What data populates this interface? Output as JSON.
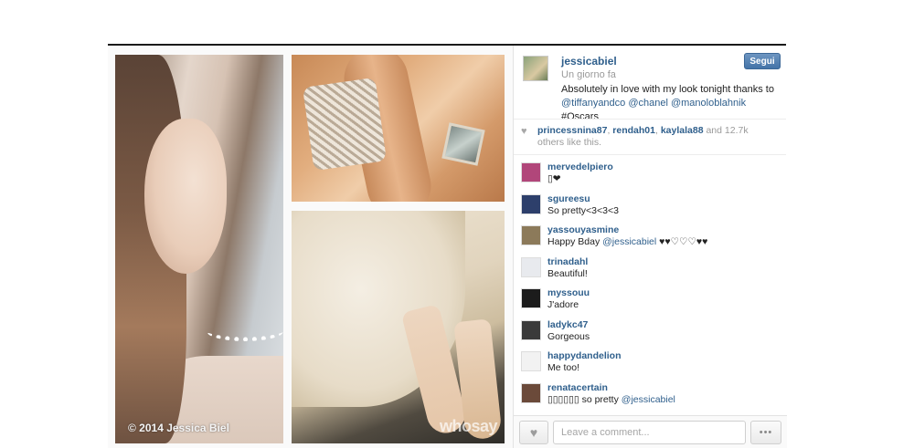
{
  "photo": {
    "credit": "© 2014 Jessica Biel",
    "watermark": "whosay"
  },
  "post": {
    "username": "jessicabiel",
    "time": "Un giorno fa",
    "caption_text": "Absolutely in love with my look tonight thanks to",
    "caption_tags": "@tiffanyandco @chanel @manoloblahnik",
    "caption_hashtag": "#Oscars",
    "follow_label": "Segui"
  },
  "likes": {
    "users": [
      "princessnina87",
      "rendah01",
      "kaylala88"
    ],
    "separator": ",",
    "and_text": "and",
    "others_count": "12.7k",
    "others_text": "others like this."
  },
  "comments": [
    {
      "user": "mervedelpiero",
      "text": "▯❤",
      "tag": "",
      "avatar_color": "#b1467a"
    },
    {
      "user": "sgureesu",
      "text": "So pretty<3<3<3",
      "tag": "",
      "avatar_color": "#2d3f6b"
    },
    {
      "user": "yassouyasmine",
      "text": "Happy Bday",
      "tag": "@jessicabiel",
      "suffix": " ♥♥♡♡♡♥♥",
      "avatar_color": "#8c7a5a"
    },
    {
      "user": "trinadahl",
      "text": "Beautiful!",
      "tag": "",
      "avatar_color": "#e8eaee"
    },
    {
      "user": "myssouu",
      "text": "J'adore",
      "tag": "",
      "avatar_color": "#1c1c1c"
    },
    {
      "user": "ladykc47",
      "text": "Gorgeous",
      "tag": "",
      "avatar_color": "#3a3a3a"
    },
    {
      "user": "happydandelion",
      "text": "Me too!",
      "tag": "",
      "avatar_color": "#f2f2f2"
    },
    {
      "user": "renatacertain",
      "text": "▯▯▯▯▯▯ so pretty",
      "tag": "@jessicabiel",
      "avatar_color": "#6b4a3a"
    }
  ],
  "comment_box": {
    "placeholder": "Leave a comment...",
    "more_label": "•••"
  },
  "icons": {
    "like": "heart-icon",
    "more": "ellipsis-icon"
  }
}
